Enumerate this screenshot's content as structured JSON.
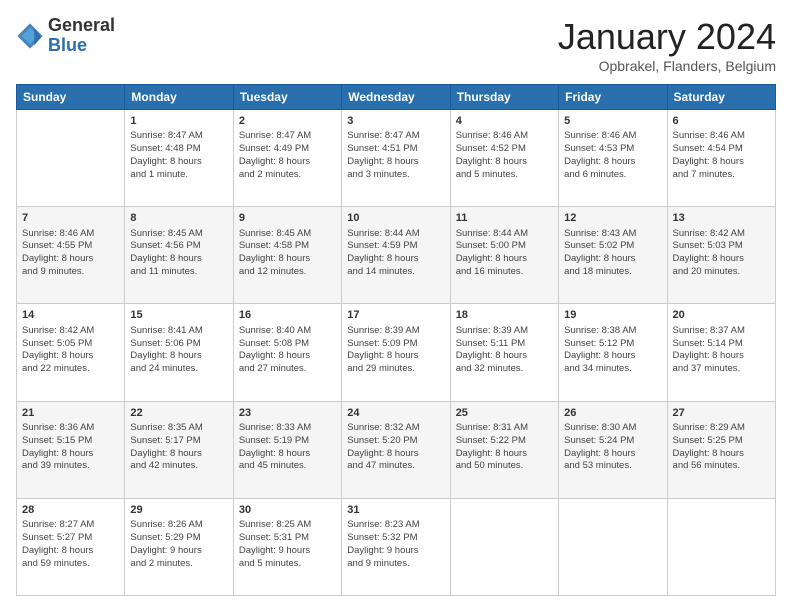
{
  "logo": {
    "general": "General",
    "blue": "Blue"
  },
  "title": "January 2024",
  "location": "Opbrakel, Flanders, Belgium",
  "days": [
    "Sunday",
    "Monday",
    "Tuesday",
    "Wednesday",
    "Thursday",
    "Friday",
    "Saturday"
  ],
  "weeks": [
    [
      {
        "num": "",
        "info": ""
      },
      {
        "num": "1",
        "info": "Sunrise: 8:47 AM\nSunset: 4:48 PM\nDaylight: 8 hours\nand 1 minute."
      },
      {
        "num": "2",
        "info": "Sunrise: 8:47 AM\nSunset: 4:49 PM\nDaylight: 8 hours\nand 2 minutes."
      },
      {
        "num": "3",
        "info": "Sunrise: 8:47 AM\nSunset: 4:51 PM\nDaylight: 8 hours\nand 3 minutes."
      },
      {
        "num": "4",
        "info": "Sunrise: 8:46 AM\nSunset: 4:52 PM\nDaylight: 8 hours\nand 5 minutes."
      },
      {
        "num": "5",
        "info": "Sunrise: 8:46 AM\nSunset: 4:53 PM\nDaylight: 8 hours\nand 6 minutes."
      },
      {
        "num": "6",
        "info": "Sunrise: 8:46 AM\nSunset: 4:54 PM\nDaylight: 8 hours\nand 7 minutes."
      }
    ],
    [
      {
        "num": "7",
        "info": "Sunrise: 8:46 AM\nSunset: 4:55 PM\nDaylight: 8 hours\nand 9 minutes."
      },
      {
        "num": "8",
        "info": "Sunrise: 8:45 AM\nSunset: 4:56 PM\nDaylight: 8 hours\nand 11 minutes."
      },
      {
        "num": "9",
        "info": "Sunrise: 8:45 AM\nSunset: 4:58 PM\nDaylight: 8 hours\nand 12 minutes."
      },
      {
        "num": "10",
        "info": "Sunrise: 8:44 AM\nSunset: 4:59 PM\nDaylight: 8 hours\nand 14 minutes."
      },
      {
        "num": "11",
        "info": "Sunrise: 8:44 AM\nSunset: 5:00 PM\nDaylight: 8 hours\nand 16 minutes."
      },
      {
        "num": "12",
        "info": "Sunrise: 8:43 AM\nSunset: 5:02 PM\nDaylight: 8 hours\nand 18 minutes."
      },
      {
        "num": "13",
        "info": "Sunrise: 8:42 AM\nSunset: 5:03 PM\nDaylight: 8 hours\nand 20 minutes."
      }
    ],
    [
      {
        "num": "14",
        "info": "Sunrise: 8:42 AM\nSunset: 5:05 PM\nDaylight: 8 hours\nand 22 minutes."
      },
      {
        "num": "15",
        "info": "Sunrise: 8:41 AM\nSunset: 5:06 PM\nDaylight: 8 hours\nand 24 minutes."
      },
      {
        "num": "16",
        "info": "Sunrise: 8:40 AM\nSunset: 5:08 PM\nDaylight: 8 hours\nand 27 minutes."
      },
      {
        "num": "17",
        "info": "Sunrise: 8:39 AM\nSunset: 5:09 PM\nDaylight: 8 hours\nand 29 minutes."
      },
      {
        "num": "18",
        "info": "Sunrise: 8:39 AM\nSunset: 5:11 PM\nDaylight: 8 hours\nand 32 minutes."
      },
      {
        "num": "19",
        "info": "Sunrise: 8:38 AM\nSunset: 5:12 PM\nDaylight: 8 hours\nand 34 minutes."
      },
      {
        "num": "20",
        "info": "Sunrise: 8:37 AM\nSunset: 5:14 PM\nDaylight: 8 hours\nand 37 minutes."
      }
    ],
    [
      {
        "num": "21",
        "info": "Sunrise: 8:36 AM\nSunset: 5:15 PM\nDaylight: 8 hours\nand 39 minutes."
      },
      {
        "num": "22",
        "info": "Sunrise: 8:35 AM\nSunset: 5:17 PM\nDaylight: 8 hours\nand 42 minutes."
      },
      {
        "num": "23",
        "info": "Sunrise: 8:33 AM\nSunset: 5:19 PM\nDaylight: 8 hours\nand 45 minutes."
      },
      {
        "num": "24",
        "info": "Sunrise: 8:32 AM\nSunset: 5:20 PM\nDaylight: 8 hours\nand 47 minutes."
      },
      {
        "num": "25",
        "info": "Sunrise: 8:31 AM\nSunset: 5:22 PM\nDaylight: 8 hours\nand 50 minutes."
      },
      {
        "num": "26",
        "info": "Sunrise: 8:30 AM\nSunset: 5:24 PM\nDaylight: 8 hours\nand 53 minutes."
      },
      {
        "num": "27",
        "info": "Sunrise: 8:29 AM\nSunset: 5:25 PM\nDaylight: 8 hours\nand 56 minutes."
      }
    ],
    [
      {
        "num": "28",
        "info": "Sunrise: 8:27 AM\nSunset: 5:27 PM\nDaylight: 8 hours\nand 59 minutes."
      },
      {
        "num": "29",
        "info": "Sunrise: 8:26 AM\nSunset: 5:29 PM\nDaylight: 9 hours\nand 2 minutes."
      },
      {
        "num": "30",
        "info": "Sunrise: 8:25 AM\nSunset: 5:31 PM\nDaylight: 9 hours\nand 5 minutes."
      },
      {
        "num": "31",
        "info": "Sunrise: 8:23 AM\nSunset: 5:32 PM\nDaylight: 9 hours\nand 9 minutes."
      },
      {
        "num": "",
        "info": ""
      },
      {
        "num": "",
        "info": ""
      },
      {
        "num": "",
        "info": ""
      }
    ]
  ]
}
